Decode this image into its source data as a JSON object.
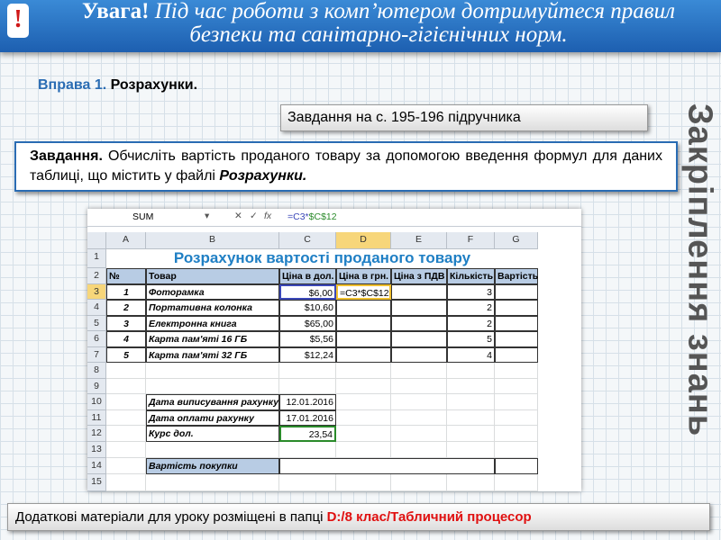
{
  "header": {
    "warn_icon": "exclamation-icon",
    "title_bold": "Увага!",
    "title_line1": " Під час роботи з комп’ютером дотримуйтеся правил",
    "title_line2": "безпеки та санітарно-гігієнічних норм."
  },
  "exercise": {
    "label": "Вправа 1.",
    "name": "Розрахунки."
  },
  "reference": "Завдання на с. 195-196 підручника",
  "task": {
    "bold": "Завдання.",
    "text": " Обчисліть вартість проданого товару за допомогою введення формул для даних таблиці, що містить у файлі ",
    "file": "Розрахунки."
  },
  "side_title": "Закріплення знань",
  "footer": {
    "text": "Додаткові матеріали для уроку розміщені в папці ",
    "path": "D:/8 клас/Табличний процесор"
  },
  "spreadsheet": {
    "name_box": "SUM",
    "formula_prefix": "=C3*",
    "formula_abs": "$C$12",
    "columns": [
      "A",
      "B",
      "C",
      "D",
      "E",
      "F",
      "G"
    ],
    "rows": [
      "1",
      "2",
      "3",
      "4",
      "5",
      "6",
      "7",
      "8",
      "9",
      "10",
      "11",
      "12",
      "13",
      "14",
      "15"
    ],
    "title": "Розрахунок вартості проданого товару",
    "headers": [
      "№",
      "Товар",
      "Ціна в дол.",
      "Ціна в грн.",
      "Ціна з ПДВ",
      "Кількість",
      "Вартість"
    ],
    "items": [
      [
        "1",
        "Фоторамка",
        "$6,00",
        "=C3*$C$12",
        "",
        "3",
        ""
      ],
      [
        "2",
        "Портативна колонка",
        "$10,60",
        "",
        "",
        "2",
        ""
      ],
      [
        "3",
        "Електронна книга",
        "$65,00",
        "",
        "",
        "2",
        ""
      ],
      [
        "4",
        "Карта пам'яті 16 ГБ",
        "$5,56",
        "",
        "",
        "5",
        ""
      ],
      [
        "5",
        "Карта пам'яті 32 ГБ",
        "$12,24",
        "",
        "",
        "4",
        ""
      ]
    ],
    "info": [
      [
        "Дата виписування рахунку",
        "12.01.2016"
      ],
      [
        "Дата оплати рахунку",
        "17.01.2016"
      ],
      [
        "Курс дол.",
        "23,54"
      ]
    ],
    "total_label": "Вартість покупки",
    "colors": {
      "title": "#1f7fc4",
      "header_fill": "#b8cce4",
      "active_col": "#f7d67a"
    }
  }
}
